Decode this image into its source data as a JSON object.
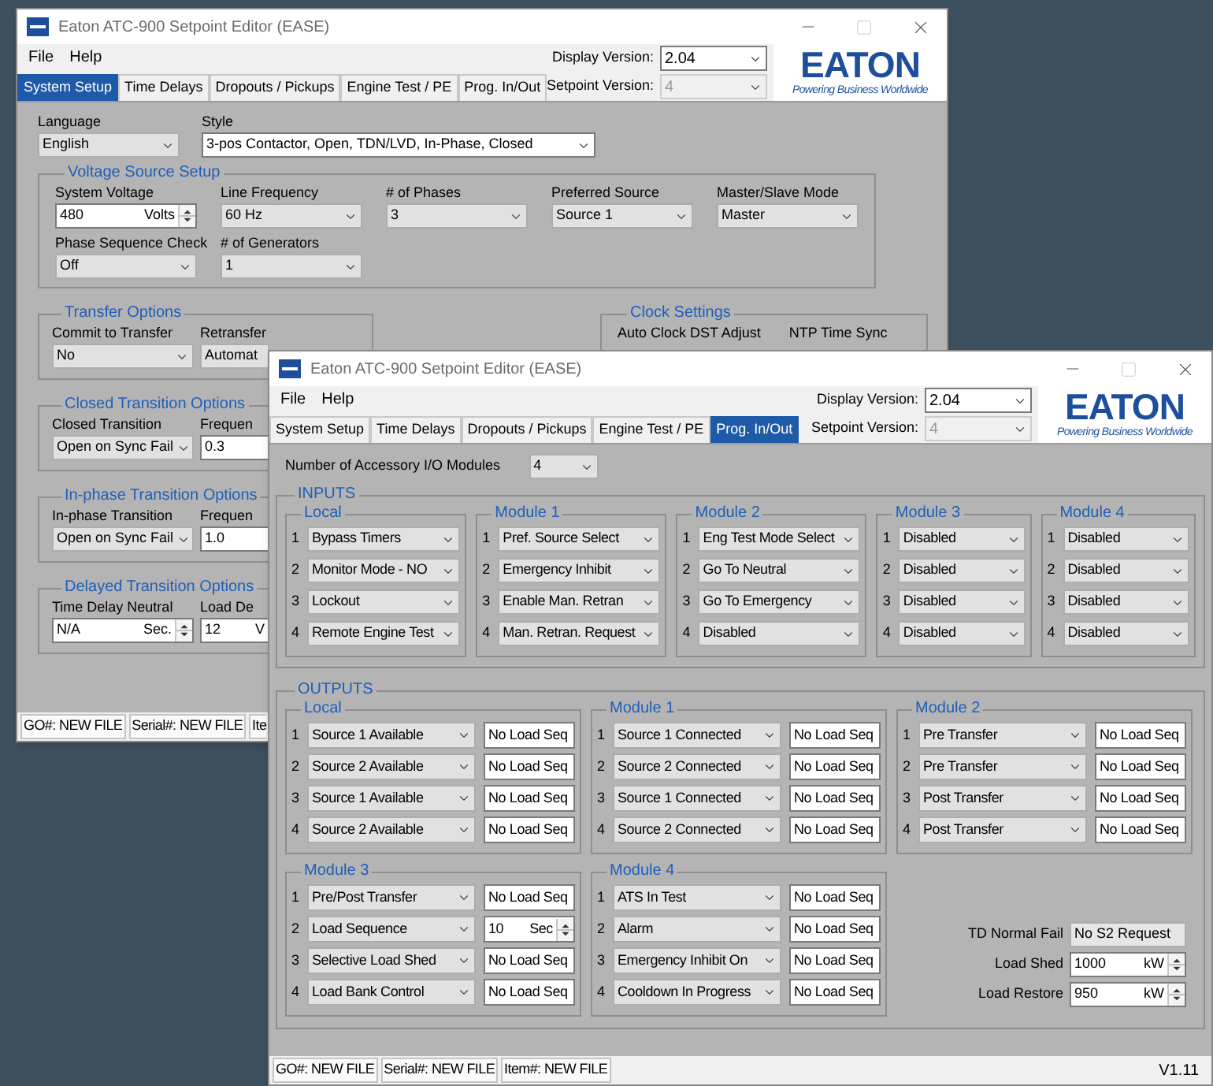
{
  "back_window": {
    "title": "Eaton ATC-900 Setpoint Editor (EASE)",
    "menu": [
      "File",
      "Help"
    ],
    "display_version": {
      "label": "Display Version:",
      "value": "2.04",
      "disabled": false
    },
    "setpoint_version": {
      "label": "Setpoint Version:",
      "value": "4",
      "disabled": true
    },
    "logo": {
      "wordmark": "EATON",
      "tagline": "Powering Business Worldwide"
    },
    "tabs": [
      {
        "label": "System Setup",
        "selected": true
      },
      {
        "label": "Time Delays",
        "selected": false
      },
      {
        "label": "Dropouts / Pickups",
        "selected": false
      },
      {
        "label": "Engine Test / PE",
        "selected": false
      },
      {
        "label": "Prog. In/Out",
        "selected": false
      }
    ],
    "language": {
      "label": "Language",
      "value": "English"
    },
    "style": {
      "label": "Style",
      "value": "3-pos Contactor, Open, TDN/LVD, In-Phase, Closed"
    },
    "voltage_source_setup": {
      "title": "Voltage Source Setup",
      "fields": [
        {
          "kind": "spin",
          "label": "System Voltage",
          "value": "480",
          "unit": "Volts"
        },
        {
          "kind": "dropdown",
          "label": "Line Frequency",
          "value": "60 Hz"
        },
        {
          "kind": "dropdown",
          "label": "# of Phases",
          "value": "3"
        },
        {
          "kind": "dropdown",
          "label": "Preferred Source",
          "value": "Source 1"
        },
        {
          "kind": "dropdown",
          "label": "Master/Slave Mode",
          "value": "Master"
        },
        {
          "kind": "dropdown",
          "label": "Phase Sequence Check",
          "value": "Off"
        },
        {
          "kind": "dropdown",
          "label": "# of Generators",
          "value": "1"
        }
      ]
    },
    "option_groups": [
      {
        "title": "Transfer Options",
        "fields": [
          {
            "kind": "dropdown",
            "label": "Commit to Transfer",
            "value": "No"
          },
          {
            "kind": "dropdown",
            "label": "Retransfer",
            "value": "Automat"
          }
        ]
      },
      {
        "title": "Closed Transition Options",
        "fields": [
          {
            "kind": "dropdown",
            "label": "Closed Transition",
            "value": "Open on Sync Fail"
          },
          {
            "kind": "text",
            "label": "Frequen",
            "value": "0.3"
          }
        ]
      },
      {
        "title": "In-phase Transition Options",
        "fields": [
          {
            "kind": "dropdown",
            "label": "In-phase Transition",
            "value": "Open on Sync Fail"
          },
          {
            "kind": "text",
            "label": "Frequen",
            "value": "1.0"
          }
        ]
      },
      {
        "title": "Delayed Transition Options",
        "fields": [
          {
            "kind": "spin",
            "label": "Time Delay Neutral",
            "value": "N/A",
            "unit": "Sec."
          },
          {
            "kind": "spin",
            "label": "Load De",
            "value": "12",
            "unit": "V"
          }
        ]
      }
    ],
    "clock_settings": {
      "title": "Clock Settings",
      "labels": [
        "Auto Clock DST Adjust",
        "NTP Time Sync"
      ]
    },
    "status_bar": {
      "cells": [
        "GO#: NEW FILE",
        "Serial#: NEW FILE",
        "Ite"
      ]
    }
  },
  "front_window": {
    "title": "Eaton ATC-900 Setpoint Editor (EASE)",
    "menu": [
      "File",
      "Help"
    ],
    "display_version": {
      "label": "Display Version:",
      "value": "2.04",
      "disabled": false
    },
    "setpoint_version": {
      "label": "Setpoint Version:",
      "value": "4",
      "disabled": true
    },
    "logo": {
      "wordmark": "EATON",
      "tagline": "Powering Business Worldwide"
    },
    "tabs": [
      {
        "label": "System Setup",
        "selected": false
      },
      {
        "label": "Time Delays",
        "selected": false
      },
      {
        "label": "Dropouts / Pickups",
        "selected": false
      },
      {
        "label": "Engine Test / PE",
        "selected": false
      },
      {
        "label": "Prog. In/Out",
        "selected": true
      }
    ],
    "module_count": {
      "label": "Number of Accessory I/O Modules",
      "value": "4"
    },
    "inputs": {
      "title": "INPUTS",
      "groups": [
        {
          "title": "Local",
          "items": [
            {
              "number": "1",
              "value": "Bypass Timers"
            },
            {
              "number": "2",
              "value": "Monitor Mode - NO"
            },
            {
              "number": "3",
              "value": "Lockout"
            },
            {
              "number": "4",
              "value": "Remote Engine Test"
            }
          ]
        },
        {
          "title": "Module 1",
          "items": [
            {
              "number": "1",
              "value": "Pref. Source Select"
            },
            {
              "number": "2",
              "value": "Emergency Inhibit"
            },
            {
              "number": "3",
              "value": "Enable Man. Retran"
            },
            {
              "number": "4",
              "value": "Man. Retran. Request"
            }
          ]
        },
        {
          "title": "Module 2",
          "items": [
            {
              "number": "1",
              "value": "Eng Test Mode Select"
            },
            {
              "number": "2",
              "value": "Go To Neutral"
            },
            {
              "number": "3",
              "value": "Go To Emergency"
            },
            {
              "number": "4",
              "value": "Disabled"
            }
          ]
        },
        {
          "title": "Module 3",
          "items": [
            {
              "number": "1",
              "value": "Disabled"
            },
            {
              "number": "2",
              "value": "Disabled"
            },
            {
              "number": "3",
              "value": "Disabled"
            },
            {
              "number": "4",
              "value": "Disabled"
            }
          ]
        },
        {
          "title": "Module 4",
          "items": [
            {
              "number": "1",
              "value": "Disabled"
            },
            {
              "number": "2",
              "value": "Disabled"
            },
            {
              "number": "3",
              "value": "Disabled"
            },
            {
              "number": "4",
              "value": "Disabled"
            }
          ]
        }
      ]
    },
    "outputs": {
      "title": "OUTPUTS",
      "groups": [
        {
          "title": "Local",
          "items": [
            {
              "kind": "text",
              "number": "1",
              "function": "Source 1 Available",
              "sequence": "No Load Seq"
            },
            {
              "kind": "text",
              "number": "2",
              "function": "Source 2 Available",
              "sequence": "No Load Seq"
            },
            {
              "kind": "text",
              "number": "3",
              "function": "Source 1 Available",
              "sequence": "No Load Seq"
            },
            {
              "kind": "text",
              "number": "4",
              "function": "Source 2 Available",
              "sequence": "No Load Seq"
            }
          ]
        },
        {
          "title": "Module 1",
          "items": [
            {
              "kind": "text",
              "number": "1",
              "function": "Source 1 Connected",
              "sequence": "No Load Seq"
            },
            {
              "kind": "text",
              "number": "2",
              "function": "Source 2 Connected",
              "sequence": "No Load Seq"
            },
            {
              "kind": "text",
              "number": "3",
              "function": "Source 1 Connected",
              "sequence": "No Load Seq"
            },
            {
              "kind": "text",
              "number": "4",
              "function": "Source 2 Connected",
              "sequence": "No Load Seq"
            }
          ]
        },
        {
          "title": "Module 2",
          "items": [
            {
              "kind": "text",
              "number": "1",
              "function": "Pre Transfer",
              "sequence": "No Load Seq"
            },
            {
              "kind": "text",
              "number": "2",
              "function": "Pre Transfer",
              "sequence": "No Load Seq"
            },
            {
              "kind": "text",
              "number": "3",
              "function": "Post Transfer",
              "sequence": "No Load Seq"
            },
            {
              "kind": "text",
              "number": "4",
              "function": "Post Transfer",
              "sequence": "No Load Seq"
            }
          ]
        },
        {
          "title": "Module 3",
          "items": [
            {
              "kind": "text",
              "number": "1",
              "function": "Pre/Post Transfer",
              "sequence": "No Load Seq"
            },
            {
              "kind": "spin",
              "number": "2",
              "function": "Load Sequence",
              "sequence": "10",
              "unit": "Sec"
            },
            {
              "kind": "text",
              "number": "3",
              "function": "Selective Load Shed",
              "sequence": "No Load Seq"
            },
            {
              "kind": "text",
              "number": "4",
              "function": "Load Bank Control",
              "sequence": "No Load Seq"
            }
          ]
        },
        {
          "title": "Module 4",
          "items": [
            {
              "kind": "text",
              "number": "1",
              "function": "ATS In Test",
              "sequence": "No Load Seq"
            },
            {
              "kind": "text",
              "number": "2",
              "function": "Alarm",
              "sequence": "No Load Seq"
            },
            {
              "kind": "text",
              "number": "3",
              "function": "Emergency Inhibit On",
              "sequence": "No Load Seq"
            },
            {
              "kind": "text",
              "number": "4",
              "function": "Cooldown In Progress",
              "sequence": "No Load Seq"
            }
          ]
        }
      ]
    },
    "load_settings": [
      {
        "kind": "readonly",
        "label": "TD Normal Fail",
        "value": "No S2 Request"
      },
      {
        "kind": "spin",
        "label": "Load Shed",
        "value": "1000",
        "unit": "kW"
      },
      {
        "kind": "spin",
        "label": "Load Restore",
        "value": "950",
        "unit": "kW"
      }
    ],
    "status_bar": {
      "cells": [
        "GO#: NEW FILE",
        "Serial#: NEW FILE",
        "Item#: NEW FILE"
      ],
      "version": "V1.11"
    }
  }
}
